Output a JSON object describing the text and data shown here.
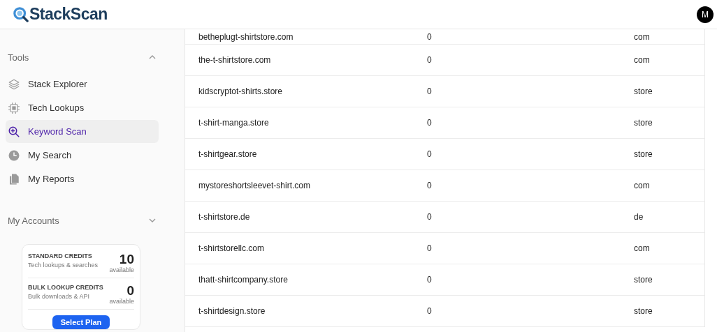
{
  "header": {
    "logo": "StackScan",
    "avatar": "M"
  },
  "sidebar": {
    "sections": [
      {
        "title": "Tools",
        "expanded": true,
        "items": [
          {
            "label": "Stack Explorer",
            "kind": "layers",
            "selected": false
          },
          {
            "label": "Tech Lookups",
            "kind": "chip",
            "selected": false
          },
          {
            "label": "Keyword Scan",
            "kind": "zoom",
            "selected": true
          },
          {
            "label": "My Search",
            "kind": "clock",
            "selected": false
          },
          {
            "label": "My Reports",
            "kind": "files",
            "selected": false
          }
        ]
      },
      {
        "title": "My Accounts",
        "expanded": false
      }
    ],
    "credits": [
      {
        "title": "STANDARD CREDITS",
        "subtitle": "Tech lookups & searches",
        "count": "10",
        "unit": "available"
      },
      {
        "title": "BULK LOOKUP CREDITS",
        "subtitle": "Bulk downloads & API",
        "count": "0",
        "unit": "available"
      }
    ],
    "button": "Select Plan"
  },
  "table": {
    "rows": [
      [
        "betheplugt-shirtstore.com",
        "0",
        "com"
      ],
      [
        "the-t-shirtstore.com",
        "0",
        "com"
      ],
      [
        "kidscryptot-shirts.store",
        "0",
        "store"
      ],
      [
        "t-shirt-manga.store",
        "0",
        "store"
      ],
      [
        "t-shirtgear.store",
        "0",
        "store"
      ],
      [
        "mystoreshortsleevet-shirt.com",
        "0",
        "com"
      ],
      [
        "t-shirtstore.de",
        "0",
        "de"
      ],
      [
        "t-shirtstorellc.com",
        "0",
        "com"
      ],
      [
        "thatt-shirtcompany.store",
        "0",
        "store"
      ],
      [
        "t-shirtdesign.store",
        "0",
        "store"
      ]
    ]
  }
}
